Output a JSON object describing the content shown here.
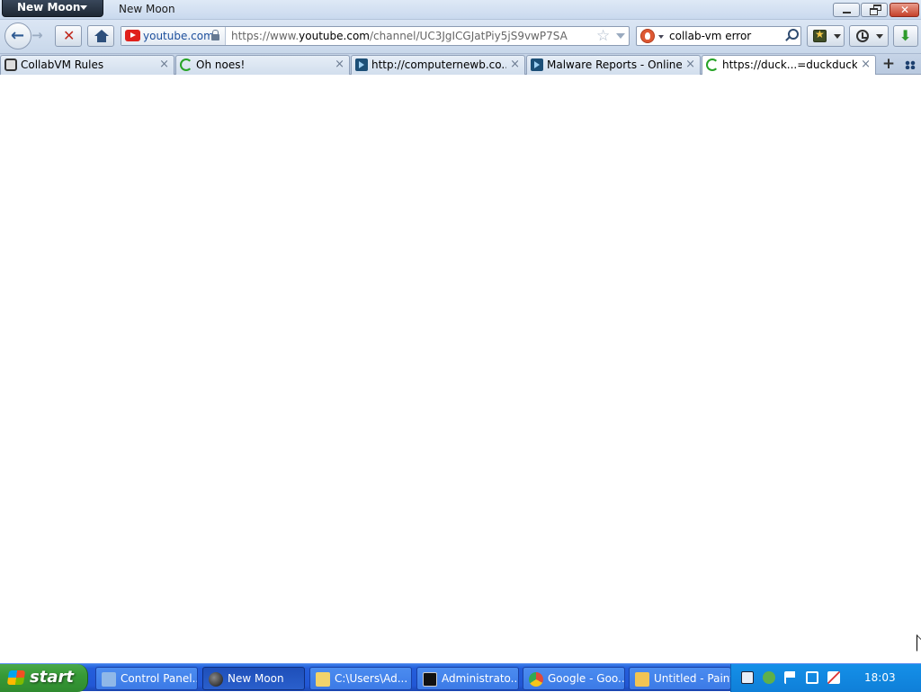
{
  "window": {
    "app_button_label": "New Moon",
    "title": "New Moon"
  },
  "navbar": {
    "identity_label": "youtube.com",
    "url_prefix": "https://www.",
    "url_host": "youtube.com",
    "url_path": "/channel/UC3JgICGJatPiy5jS9vwP7SA",
    "search_value": "collab-vm error",
    "stop_glyph": "✕",
    "back_glyph": "←",
    "forward_glyph": "→",
    "star_glyph": "☆",
    "download_glyph": "⬇"
  },
  "tabs": [
    {
      "label": "CollabVM Rules",
      "icon": "puzzle-icon",
      "close": "×"
    },
    {
      "label": "Oh noes!",
      "icon": "loading-throbber-icon",
      "close": "×"
    },
    {
      "label": "http://computernewb.co...",
      "icon": "video-player-icon",
      "close": "×"
    },
    {
      "label": "Malware Reports - Online ...",
      "icon": "video-player-icon",
      "close": "×"
    },
    {
      "label": "https://duck...=duckduck_in",
      "icon": "loading-throbber-icon",
      "close": "×",
      "active": true
    }
  ],
  "tabstrip": {
    "new_tab_glyph": "+"
  },
  "taskbar": {
    "start_label": "start",
    "tasks": [
      {
        "label": "Control Panel...",
        "icon": "control-panel-icon",
        "color": "#8fb8e8"
      },
      {
        "label": "New Moon",
        "icon": "new-moon-icon",
        "color": "#222222",
        "active": true
      },
      {
        "label": "C:\\Users\\Ad...",
        "icon": "folder-icon",
        "color": "#f2d36b"
      },
      {
        "label": "Administrato...",
        "icon": "command-prompt-icon",
        "color": "#111111"
      },
      {
        "label": "Google - Goo...",
        "icon": "chrome-icon",
        "color": "#e04a3a"
      },
      {
        "label": "Untitled - Paint",
        "icon": "paint-icon",
        "color": "#f1c453"
      }
    ],
    "clock": "18:03"
  },
  "colors": {
    "taskbar_blue": "#245edb",
    "start_green": "#379a37",
    "close_red": "#c5412b",
    "throbber_green": "#27a327"
  }
}
